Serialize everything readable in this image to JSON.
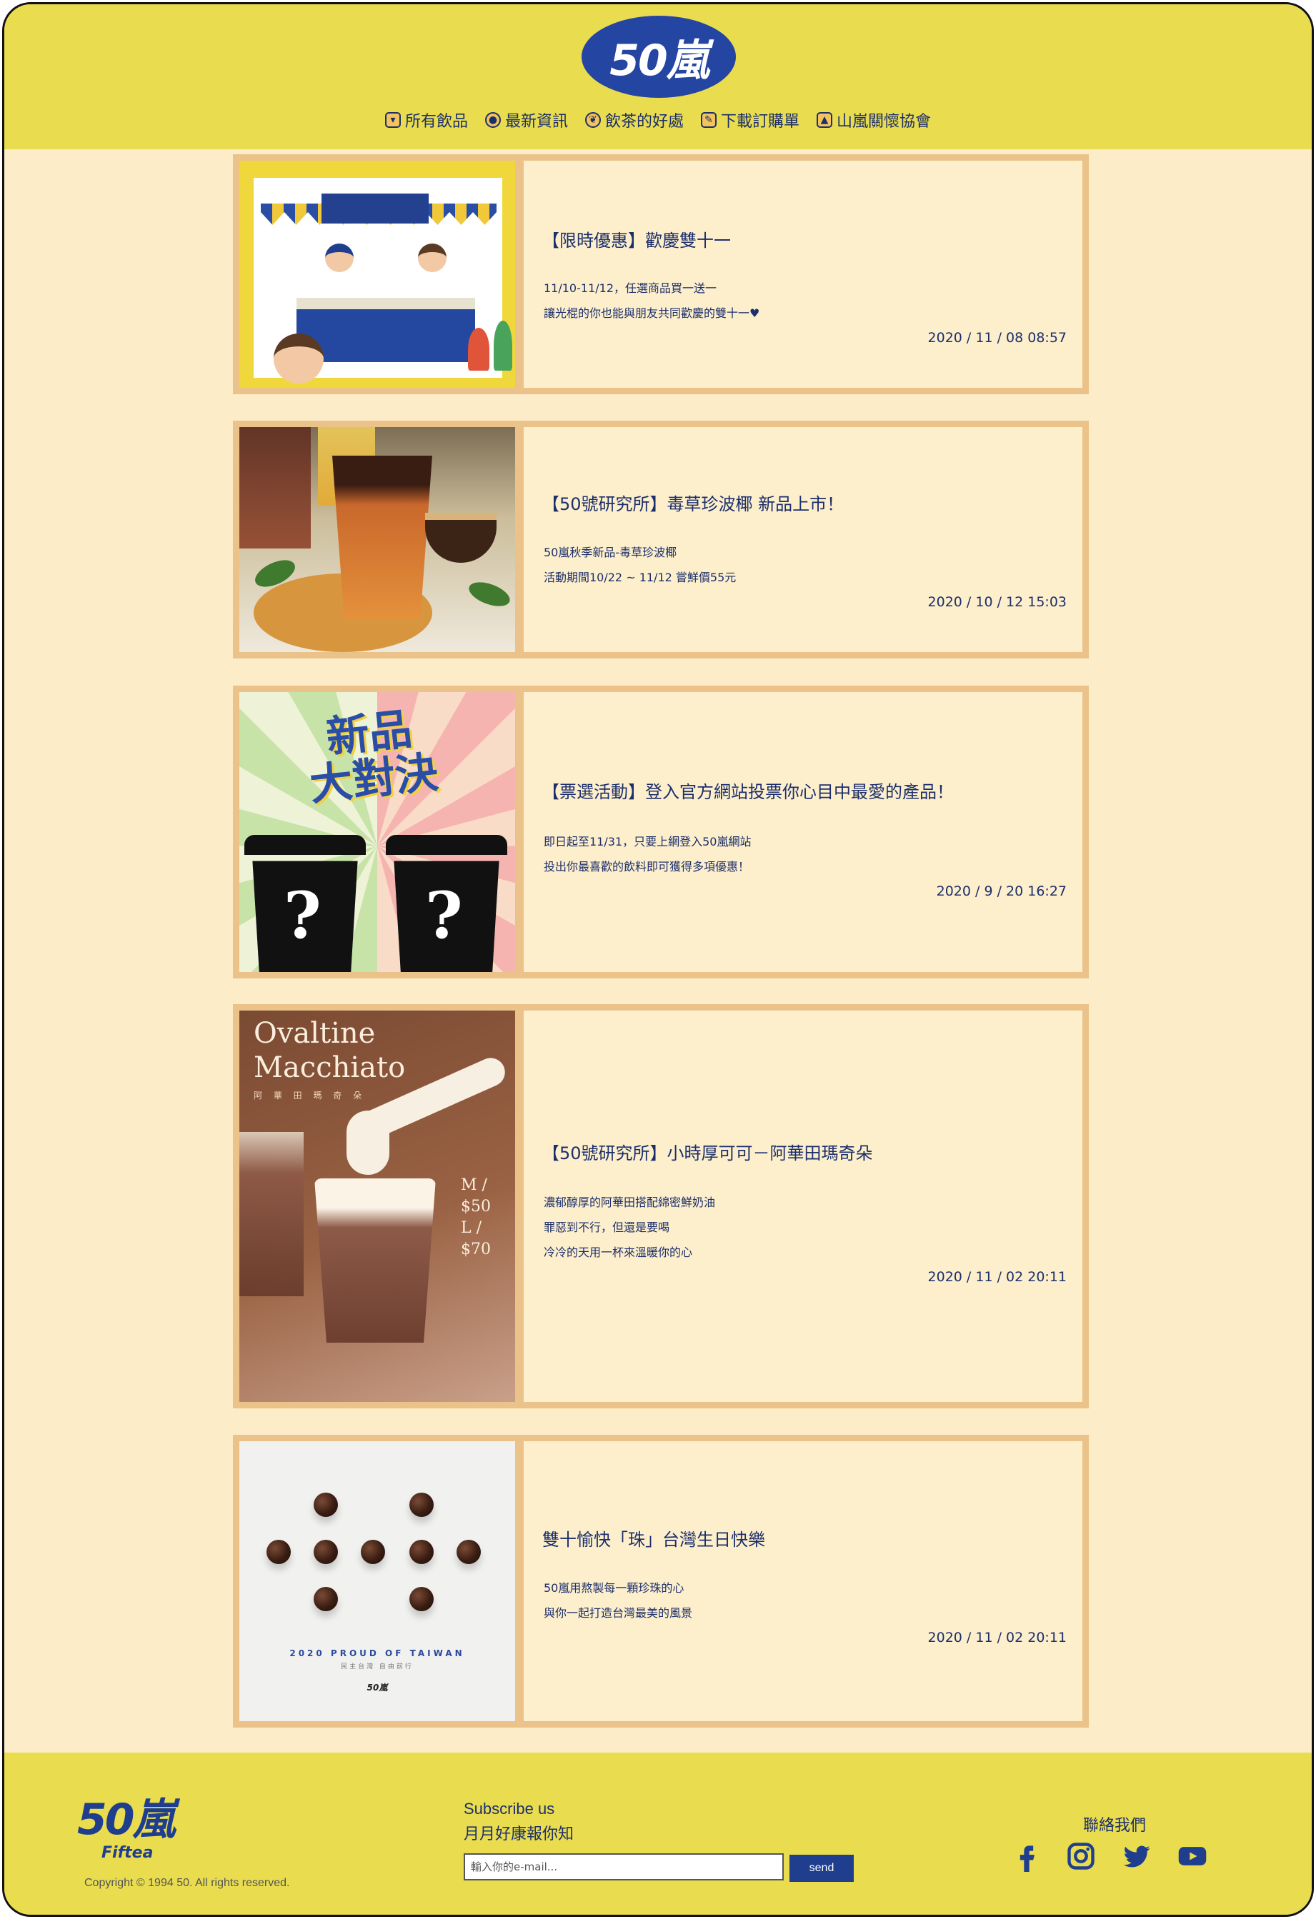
{
  "brand": {
    "logo_text": "50嵐",
    "logo_sub": "Fiftea"
  },
  "nav": [
    {
      "label": "所有飲品",
      "icon": "cup-icon"
    },
    {
      "label": "最新資訊",
      "icon": "info-icon"
    },
    {
      "label": "飲茶的好處",
      "icon": "leaf-icon"
    },
    {
      "label": "下載訂購單",
      "icon": "order-form-icon"
    },
    {
      "label": "山嵐關懷協會",
      "icon": "mountain-icon"
    }
  ],
  "posts": [
    {
      "title": "【限時優惠】歡慶雙十一",
      "lines": [
        "11/10-11/12，任選商品買一送一",
        "讓光棍的你也能與朋友共同歡慶的雙十一♥"
      ],
      "date": "2020 / 11 / 08 08:57"
    },
    {
      "title": "【50號研究所】毒草珍波椰 新品上市！",
      "lines": [
        "50嵐秋季新品-毒草珍波椰",
        "活動期間10/22 ~ 11/12 嘗鮮價55元"
      ],
      "date": "2020 / 10 / 12 15:03"
    },
    {
      "title": "【票選活動】登入官方網站投票你心目中最愛的產品！",
      "lines": [
        "即日起至11/31，只要上網登入50嵐網站",
        "投出你最喜歡的飲料即可獲得多項優惠！"
      ],
      "image_text": [
        "新品",
        "大對決"
      ],
      "date": "2020 / 9 / 20 16:27"
    },
    {
      "title": "【50號研究所】小時厚可可－阿華田瑪奇朵",
      "lines": [
        "濃郁醇厚的阿華田搭配綿密鮮奶油",
        "罪惡到不行，但還是要喝",
        "冷冷的天用一杯來溫暖你的心"
      ],
      "image_text": [
        "Ovaltine",
        "Macchiato",
        "阿 華 田 瑪 奇 朵",
        "M / $50",
        "L / $70"
      ],
      "date": "2020 / 11 / 02 20:11"
    },
    {
      "title": "雙十愉快「珠」台灣生日快樂",
      "lines": [
        "50嵐用熬製每一顆珍珠的心",
        "與你一起打造台灣最美的風景"
      ],
      "image_text": [
        "2020 PROUD OF TAIWAN",
        "民主台灣 自由前行",
        "50嵐"
      ],
      "date": "2020 / 11 / 02 20:11"
    }
  ],
  "footer": {
    "copyright": "Copyright © 1994 50. All rights reserved.",
    "subscribe_title": "Subscribe us",
    "subscribe_sub": "月月好康報你知",
    "email_placeholder": "輸入你的e-mail...",
    "send_label": "send",
    "contact_label": "聯絡我們",
    "social": [
      "facebook-icon",
      "instagram-icon",
      "twitter-icon",
      "youtube-icon"
    ]
  },
  "colors": {
    "header_yellow": "#e9dc4f",
    "page_cream": "#fdecc8",
    "card_border": "#eac28a",
    "brand_blue": "#1f3f8e"
  }
}
